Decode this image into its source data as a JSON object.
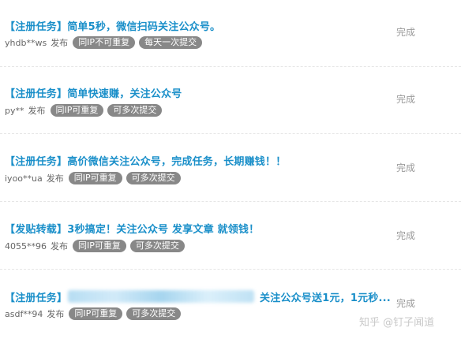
{
  "tasks": [
    {
      "title": "【注册任务】简单5秒，微信扫码关注公众号。",
      "user": "yhdb**ws",
      "publish": "发布",
      "tags": [
        "同IP不可重复",
        "每天一次提交"
      ],
      "status": "完成"
    },
    {
      "title": "【注册任务】简单快速赚，关注公众号",
      "user": "py**",
      "publish": "发布",
      "tags": [
        "同IP可重复",
        "可多次提交"
      ],
      "status": "完成"
    },
    {
      "title": "【注册任务】高价微信关注公众号，完成任务，长期赚钱！！",
      "user": "iyoo**ua",
      "publish": "发布",
      "tags": [
        "同IP可重复",
        "可多次提交"
      ],
      "status": "完成"
    },
    {
      "title": "【发贴转载】3秒搞定！关注公众号 发享文章 就领钱！",
      "user": "4055**96",
      "publish": "发布",
      "tags": [
        "同IP可重复",
        "可多次提交"
      ],
      "status": "完成"
    },
    {
      "title": "【注册任务】",
      "title_suffix": "关注公众号送1元，1元秒...",
      "user": "asdf**94",
      "publish": "发布",
      "tags": [
        "同IP可重复",
        "可多次提交"
      ],
      "status": "完成"
    }
  ],
  "watermark": "知乎 @钉子闻道"
}
